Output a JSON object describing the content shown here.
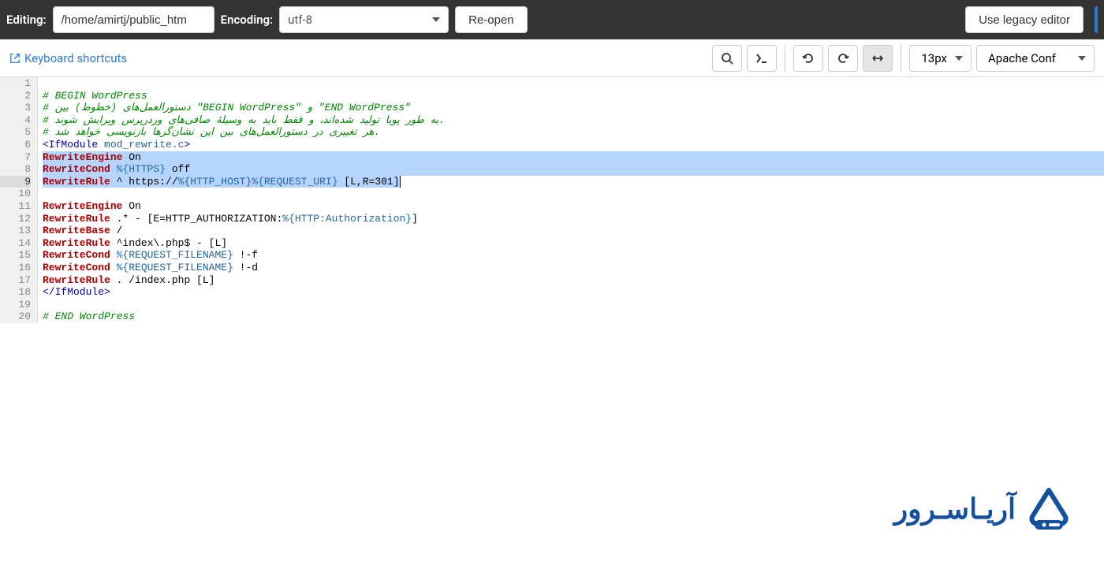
{
  "topbar": {
    "editing_label": "Editing:",
    "path": "/home/amirtj/public_htm",
    "encoding_label": "Encoding:",
    "encoding_value": "utf-8",
    "reopen": "Re-open",
    "legacy": "Use legacy editor"
  },
  "toolbar": {
    "shortcuts": "Keyboard shortcuts",
    "font_size": "13px",
    "language": "Apache Conf"
  },
  "gutter": [
    "1",
    "2",
    "3",
    "4",
    "5",
    "6",
    "7",
    "8",
    "9",
    "10",
    "11",
    "12",
    "13",
    "14",
    "15",
    "16",
    "17",
    "18",
    "19",
    "20"
  ],
  "active_line_index": 8,
  "code": {
    "l1": "",
    "l2_hash": "# ",
    "l2_a": "BEGIN WordPress",
    "l3_hash": "# ",
    "l3_a": "دستورالعمل",
    "l3_inv": "‌",
    "l3_b": "های (خطوط) بین ",
    "l3_c": "\"BEGIN WordPress\"",
    "l3_d": " و ",
    "l3_e": "\"END WordPress\"",
    "l4_hash": "# ",
    "l4_a": "به طور پویا تولید شده",
    "l4_b": "اند، و فقط باید به وسیلهٔ صافی",
    "l4_c": "های وردرپرس ویرایش شوند",
    "l4_dot": ".",
    "l5_hash": "# ",
    "l5_a": "هر تغییری در دستورالعمل",
    "l5_b": "های بین این نشان",
    "l5_c": "گرها بازنویسی خواهد شد",
    "l5_dot": ".",
    "l6_a": "<IfModule",
    "l6_b": " mod_rewrite.c",
    "l6_c": ">",
    "l7_a": "RewriteEngine",
    "l7_b": " On",
    "l8_a": "RewriteCond",
    "l8_b": " %{HTTPS}",
    "l8_c": " off",
    "l9_a": "RewriteRule",
    "l9_b": " ^ https://",
    "l9_c": "%{HTTP_HOST}%{REQUEST_URI}",
    "l9_d": " [L,R=301]",
    "l10": "",
    "l11_a": "RewriteEngine",
    "l11_b": " On",
    "l12_a": "RewriteRule",
    "l12_b": " .* - [E=HTTP_AUTHORIZATION:",
    "l12_c": "%{HTTP:Authorization}",
    "l12_d": "]",
    "l13_a": "RewriteBase",
    "l13_b": " /",
    "l14_a": "RewriteRule",
    "l14_b": " ^index\\.php$ - [L]",
    "l15_a": "RewriteCond",
    "l15_b": " %{REQUEST_FILENAME}",
    "l15_c": " !-f",
    "l16_a": "RewriteCond",
    "l16_b": " %{REQUEST_FILENAME}",
    "l16_c": " !-d",
    "l17_a": "RewriteRule",
    "l17_b": " . /index.php [L]",
    "l18": "</IfModule>",
    "l19": "",
    "l20_hash": "# ",
    "l20_a": "END WordPress"
  },
  "watermark": "آریـاسـرور"
}
